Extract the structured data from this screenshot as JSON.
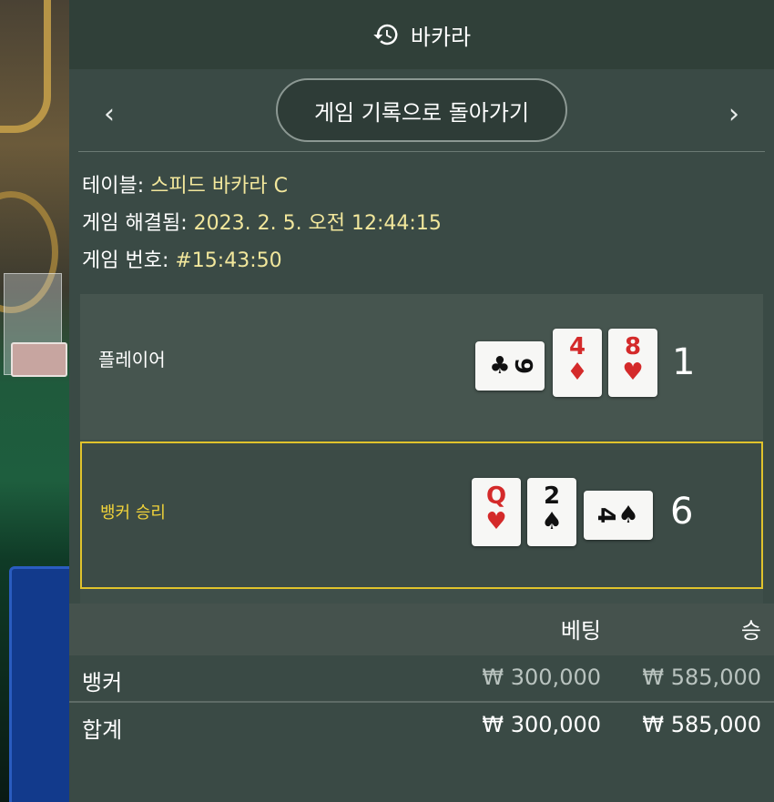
{
  "header": {
    "title": "바카라",
    "icon": "history-icon"
  },
  "nav": {
    "back_label": "게임 기록으로 돌아가기",
    "prev_icon": "chevron-left-icon",
    "next_icon": "chevron-right-icon"
  },
  "info": {
    "table_label": "테이블: ",
    "table_value": "스피드 바카라 C",
    "resolved_label": "게임 해결됨: ",
    "resolved_value": "2023. 2. 5. 오전 12:44:15",
    "game_no_label": "게임 번호: ",
    "game_no_value": "#15:43:50"
  },
  "player": {
    "label": "플레이어",
    "score": "1",
    "cards": [
      {
        "rank": "9",
        "suit": "♣",
        "color": "black",
        "orientation": "sideways"
      },
      {
        "rank": "4",
        "suit": "♦",
        "color": "red",
        "orientation": "upright"
      },
      {
        "rank": "8",
        "suit": "♥",
        "color": "red",
        "orientation": "upright"
      }
    ]
  },
  "banker": {
    "label": "뱅커 승리",
    "score": "6",
    "cards": [
      {
        "rank": "Q",
        "suit": "♥",
        "color": "red",
        "orientation": "upright"
      },
      {
        "rank": "2",
        "suit": "♠",
        "color": "black",
        "orientation": "upright"
      },
      {
        "rank": "4",
        "suit": "♠",
        "color": "black",
        "orientation": "sideways"
      }
    ]
  },
  "table": {
    "headers": [
      "",
      "베팅",
      "승"
    ],
    "rows": [
      {
        "name": "뱅커",
        "bet": "₩ 300,000",
        "win": "₩ 585,000"
      }
    ],
    "total": {
      "name": "합계",
      "bet": "₩ 300,000",
      "win": "₩ 585,000"
    }
  },
  "colors": {
    "highlight": "#e0c32c",
    "info_value": "#f2e79c",
    "panel": "#3a4a45"
  }
}
